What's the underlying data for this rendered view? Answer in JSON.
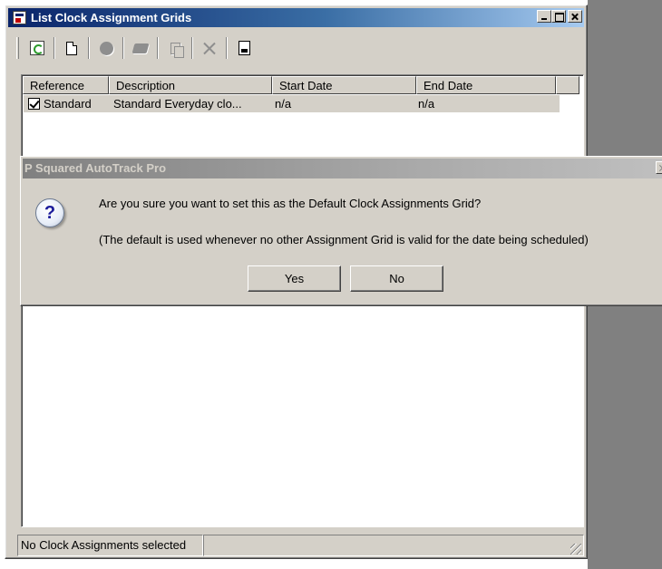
{
  "window": {
    "title": "List Clock Assignment Grids"
  },
  "list": {
    "columns": [
      "Reference",
      "Description",
      "Start Date",
      "End Date"
    ],
    "rows": [
      {
        "checked": true,
        "reference": "Standard",
        "description": "Standard Everyday clo...",
        "start_date": "n/a",
        "end_date": "n/a"
      }
    ]
  },
  "status_bar": {
    "text": "No Clock Assignments selected"
  },
  "dialog": {
    "title": "P Squared AutoTrack Pro",
    "message": "Are you sure you want to set this as the Default Clock Assignments Grid?",
    "note": "(The default is used whenever no other Assignment Grid is valid for the date being scheduled)",
    "yes_label": "Yes",
    "no_label": "No"
  }
}
